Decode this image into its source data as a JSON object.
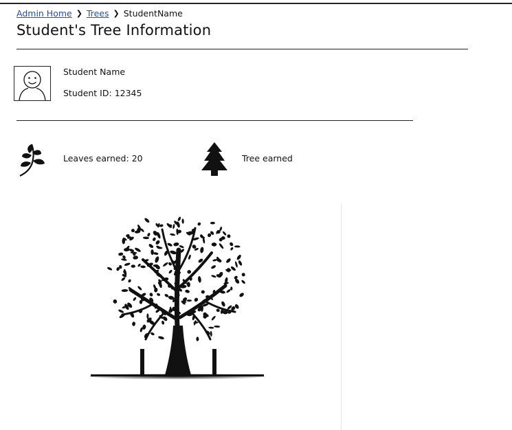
{
  "breadcrumb": {
    "items": [
      {
        "label": "Admin Home",
        "link": true
      },
      {
        "label": "Trees",
        "link": true
      },
      {
        "label": "StudentName",
        "link": false
      }
    ]
  },
  "page": {
    "title": "Student's Tree Information"
  },
  "student": {
    "name": "Student Name",
    "id_label": "Student ID:",
    "id_value": "12345",
    "avatar_icon": "user-avatar-icon"
  },
  "stats": {
    "leaves_label": "Leaves earned:",
    "leaves_value": "20",
    "leaf_icon": "leaf-branch-icon",
    "tree_label": "Tree earned",
    "tree_icon": "pine-tree-icon"
  },
  "image": {
    "icon": "tree-illustration"
  },
  "colors": {
    "link": "#1f4fa8",
    "rule": "#222222"
  }
}
